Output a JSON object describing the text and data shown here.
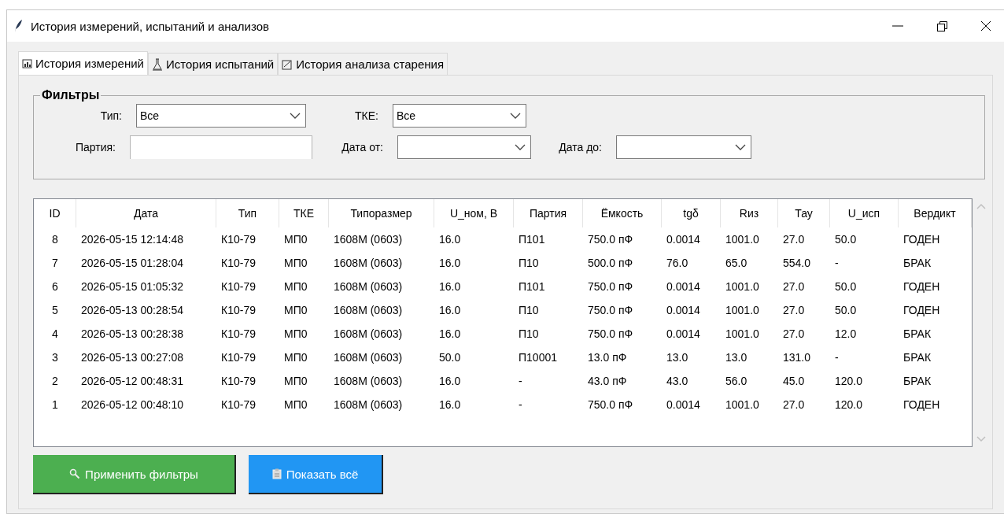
{
  "window": {
    "title": "История измерений, испытаний и анализов"
  },
  "tabs": [
    {
      "label": "История измерений",
      "selected": true,
      "kind": "chart"
    },
    {
      "label": "История испытаний",
      "selected": false,
      "kind": "flask"
    },
    {
      "label": "История анализа старения",
      "selected": false,
      "kind": "check"
    }
  ],
  "filters": {
    "title": "Фильтры",
    "fields": [
      {
        "label": "Тип:",
        "kind": "combo",
        "value": "Все"
      },
      {
        "label": "ТКЕ:",
        "kind": "combo",
        "value": "Все"
      },
      {
        "label": "Партия:",
        "kind": "entry"
      },
      {
        "label": "Дата от:",
        "kind": "combo"
      },
      {
        "label": "Дата до:",
        "kind": "combo"
      }
    ]
  },
  "table": {
    "columns": [
      "ID",
      "Дата",
      "Тип",
      "ТКЕ",
      "Типоразмер",
      "U_ном, В",
      "Партия",
      "Ёмкость",
      "tgδ",
      "Rиз",
      "Тау",
      "U_исп",
      "Вердикт"
    ],
    "rows": [
      [
        "8",
        "2026-05-15 12:14:48",
        "К10-79",
        "МП0",
        "1608M (0603)",
        "16.0",
        "П101",
        "750.0 пФ",
        "0.0014",
        "1001.0",
        "27.0",
        "50.0",
        "ГОДЕН"
      ],
      [
        "7",
        "2026-05-15 01:28:04",
        "К10-79",
        "МП0",
        "1608M (0603)",
        "16.0",
        "П10",
        "500.0 пФ",
        "76.0",
        "65.0",
        "554.0",
        "-",
        "БРАК"
      ],
      [
        "6",
        "2026-05-15 01:05:32",
        "К10-79",
        "МП0",
        "1608M (0603)",
        "16.0",
        "П101",
        "750.0 пФ",
        "0.0014",
        "1001.0",
        "27.0",
        "50.0",
        "ГОДЕН"
      ],
      [
        "5",
        "2026-05-13 00:28:54",
        "К10-79",
        "МП0",
        "1608M (0603)",
        "16.0",
        "П10",
        "750.0 пФ",
        "0.0014",
        "1001.0",
        "27.0",
        "50.0",
        "ГОДЕН"
      ],
      [
        "4",
        "2026-05-13 00:28:38",
        "К10-79",
        "МП0",
        "1608M (0603)",
        "16.0",
        "П10",
        "750.0 пФ",
        "0.0014",
        "1001.0",
        "27.0",
        "12.0",
        "БРАК"
      ],
      [
        "3",
        "2026-05-13 00:27:08",
        "К10-79",
        "МП0",
        "1608M (0603)",
        "50.0",
        "П10001",
        "13.0 пФ",
        "13.0",
        "13.0",
        "131.0",
        "-",
        "БРАК"
      ],
      [
        "2",
        "2026-05-12 00:48:31",
        "К10-79",
        "МП0",
        "1608M (0603)",
        "16.0",
        "-",
        "43.0 пФ",
        "43.0",
        "56.0",
        "45.0",
        "120.0",
        "БРАК"
      ],
      [
        "1",
        "2026-05-12 00:48:10",
        "К10-79",
        "МП0",
        "1608M (0603)",
        "16.0",
        "-",
        "750.0 пФ",
        "0.0014",
        "1001.0",
        "27.0",
        "120.0",
        "ГОДЕН"
      ]
    ]
  },
  "buttons": [
    {
      "label": "Применить фильтры",
      "kind": "apply",
      "color": "#4caf50"
    },
    {
      "label": "Показать всё",
      "kind": "show",
      "color": "#2196f3"
    }
  ]
}
